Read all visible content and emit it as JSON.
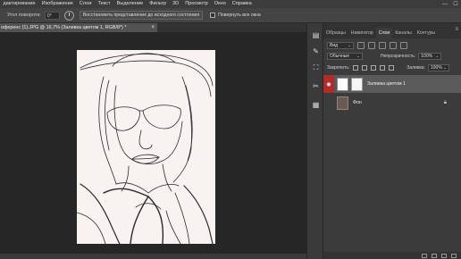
{
  "menu": [
    "дактирование",
    "Изображение",
    "Слои",
    "Текст",
    "Выделение",
    "Фильтр",
    "3D",
    "Просмотр",
    "Окно",
    "Справка"
  ],
  "window_controls": [
    "—",
    "☐"
  ],
  "options": {
    "angle_label": "Угол поворота:",
    "angle_value": "0°",
    "restore_button": "Восстановить представление до исходного состояния",
    "rotate_all_label": "Повернуть все окна"
  },
  "document": {
    "tab_title": "оференс (1).JPG @ 16,7% (Заливка цветом 1, RGB/8*) *",
    "close": "×"
  },
  "panels": {
    "tabs": [
      "Образцы",
      "Навигатор",
      "Слои",
      "Каналы",
      "Контуры"
    ],
    "active_tab": "Слои",
    "menu_icon": "≡",
    "filter_kind": "Вид",
    "blend_mode": "Обычные",
    "opacity_label": "Непрозрачность:",
    "opacity_value": "100%",
    "lock_label": "Закрепить:",
    "fill_label": "Заливка:",
    "fill_value": "100%",
    "layers": [
      {
        "name": "Заливка цветом 1",
        "visible": true,
        "selected": true
      },
      {
        "name": "Фон",
        "visible": false,
        "selected": false,
        "locked": true
      }
    ]
  },
  "toolstrip_icons": [
    "layers-icon",
    "brush-icon",
    "stamp-icon",
    "tools-icon",
    "properties-icon"
  ],
  "colors": {
    "accent_eye": "#b22a2a",
    "canvas_bg": "#f8f2f0",
    "workspace": "#262626"
  }
}
